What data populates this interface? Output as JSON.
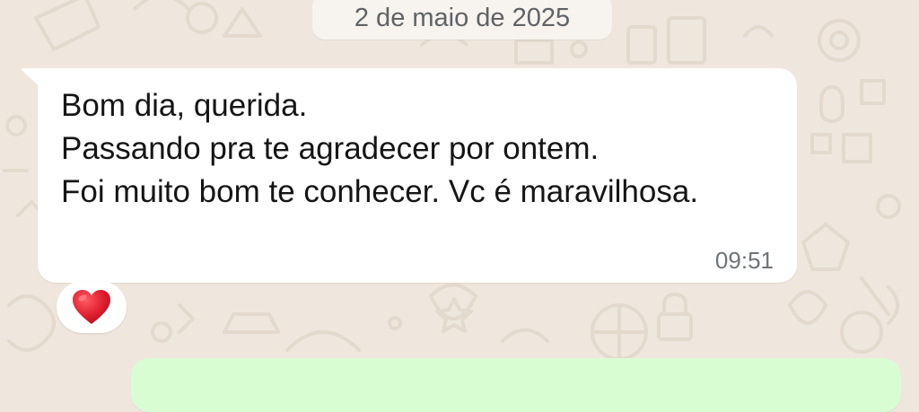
{
  "chat": {
    "date_separator": "2 de maio de 2025",
    "incoming_message": {
      "text": "Bom dia, querida.\nPassando pra te agradecer por ontem.\nFoi muito bom te conhecer. Vc é maravilhosa.",
      "time": "09:51",
      "reaction_icon": "red-heart-icon"
    },
    "outgoing_message": {
      "text": ""
    }
  },
  "colors": {
    "wallpaper": "#efe7de",
    "wallpaper_doodle": "#e5dbd0",
    "incoming_bubble": "#ffffff",
    "outgoing_bubble": "#d9fdd3",
    "date_chip": "#f7f3ee",
    "heart": "#e0202f"
  }
}
